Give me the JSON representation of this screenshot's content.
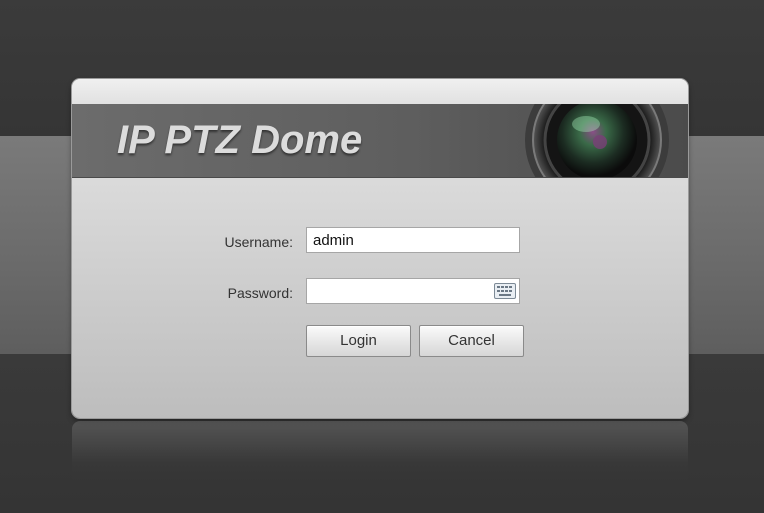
{
  "banner": {
    "title": "IP PTZ Dome",
    "lens_icon": "camera-lens-icon"
  },
  "login_form": {
    "username_label": "Username:",
    "username_value": "admin",
    "password_label": "Password:",
    "password_value": "",
    "keyboard_icon": "keyboard-icon",
    "login_button_label": "Login",
    "cancel_button_label": "Cancel"
  },
  "colors": {
    "background_dark": "#3a3a3a",
    "background_band": "#6e6e6e",
    "banner": "#5e5e5e",
    "panel": "#d6d6d6"
  }
}
